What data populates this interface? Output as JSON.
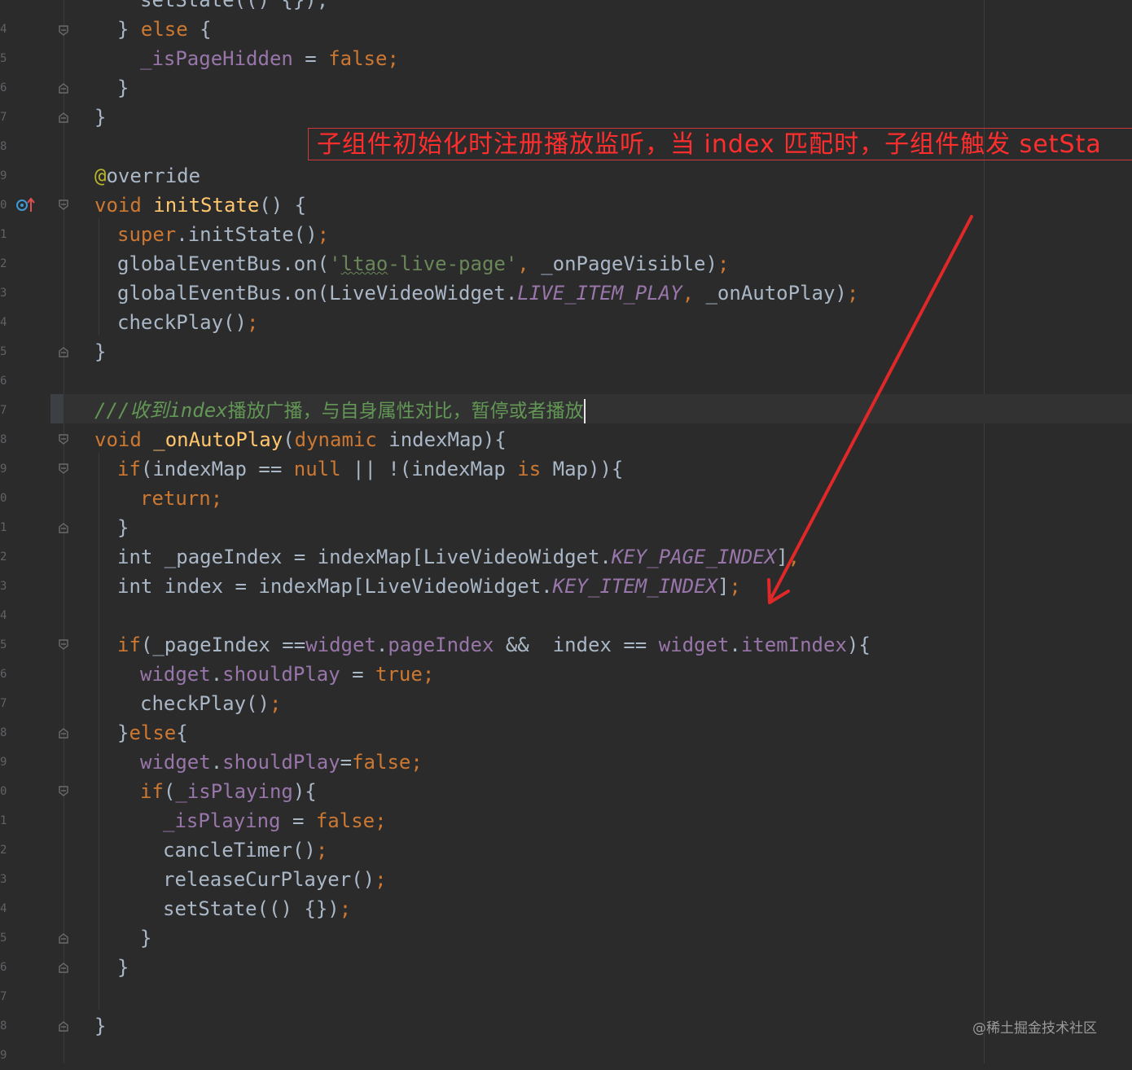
{
  "editor": {
    "line_number_partials": [
      "4",
      "5",
      "6",
      "7",
      "8",
      "9",
      "0",
      "1",
      "2",
      "3",
      "4",
      "5",
      "6",
      "7",
      "8",
      "9",
      "0",
      "1",
      "2",
      "3",
      "4",
      "5",
      "6",
      "7",
      "8",
      "9",
      "0",
      "1",
      "2",
      "3",
      "4",
      "5",
      "6",
      "7",
      "8",
      "9"
    ],
    "code": {
      "l0": "setState(() {});",
      "l1_a": "} ",
      "l1_b": "else",
      "l1_c": " {",
      "l2_a": "_isPageHidden",
      "l2_b": " = ",
      "l2_c": "false",
      "l2_d": ";",
      "l3": "}",
      "l4": "}",
      "l6_a": "@",
      "l6_b": "override",
      "l7_a": "void",
      "l7_b": " ",
      "l7_c": "initState",
      "l7_d": "() {",
      "l8_a": "super",
      "l8_b": ".initState()",
      "l8_c": ";",
      "l9_a": "globalEventBus.on(",
      "l9_b": "'",
      "l9_c": "ltao",
      "l9_d": "-live-page'",
      "l9_e": ", ",
      "l9_f": "_onPageVisible)",
      "l9_g": ";",
      "l10_a": "globalEventBus.on(LiveVideoWidget.",
      "l10_b": "LIVE_ITEM_PLAY",
      "l10_c": ", ",
      "l10_d": "_onAutoPlay)",
      "l10_e": ";",
      "l11_a": "checkPlay()",
      "l11_b": ";",
      "l12": "}",
      "l14_a": "///收到",
      "l14_b": "index",
      "l14_c": "播放广播，与自身属性对比，暂停或者播放",
      "l15_a": "void",
      "l15_b": " ",
      "l15_c": "_onAutoPlay",
      "l15_d": "(",
      "l15_e": "dynamic",
      "l15_f": " indexMap){",
      "l16_a": "if",
      "l16_b": "(indexMap == ",
      "l16_c": "null",
      "l16_d": " || !(indexMap ",
      "l16_e": "is",
      "l16_f": " Map)){",
      "l17_a": "return",
      "l17_b": ";",
      "l18": "}",
      "l19_a": "int",
      "l19_b": " _pageIndex = indexMap[LiveVideoWidget.",
      "l19_c": "KEY_PAGE_INDEX",
      "l19_d": "]",
      "l19_e": ";",
      "l20_a": "int",
      "l20_b": " index = indexMap[LiveVideoWidget.",
      "l20_c": "KEY_ITEM_INDEX",
      "l20_d": "]",
      "l20_e": ";",
      "l22_a": "if",
      "l22_b": "(_pageIndex ==",
      "l22_c": "widget",
      "l22_d": ".",
      "l22_e": "pageIndex",
      "l22_f": " &&  index == ",
      "l22_g": "widget",
      "l22_h": ".",
      "l22_i": "itemIndex",
      "l22_j": "){",
      "l23_a": "widget",
      "l23_b": ".",
      "l23_c": "shouldPlay",
      "l23_d": " = ",
      "l23_e": "true",
      "l23_f": ";",
      "l24_a": "checkPlay()",
      "l24_b": ";",
      "l25_a": "}",
      "l25_b": "else",
      "l25_c": "{",
      "l26_a": "widget",
      "l26_b": ".",
      "l26_c": "shouldPlay",
      "l26_d": "=",
      "l26_e": "false",
      "l26_f": ";",
      "l27_a": "if",
      "l27_b": "(",
      "l27_c": "_isPlaying",
      "l27_d": "){",
      "l28_a": "_isPlaying",
      "l28_b": " = ",
      "l28_c": "false",
      "l28_d": ";",
      "l29_a": "cancleTimer()",
      "l29_b": ";",
      "l30_a": "releaseCurPlayer()",
      "l30_b": ";",
      "l31_a": "setState(() {})",
      "l31_b": ";",
      "l32": "}",
      "l33": "}",
      "l35": "}"
    }
  },
  "annotation": {
    "text": "子组件初始化时注册播放监听，当 index 匹配时，子组件触发 setSta",
    "color": "#ff2e2e"
  },
  "watermark": "@稀土掘金技术社区",
  "colors": {
    "background": "#2b2b2b",
    "keyword": "#cc7832",
    "function": "#ffc66d",
    "string": "#6a8759",
    "field": "#9876aa",
    "annotation_arrow": "#e02828"
  },
  "icons": [
    "fold-icon",
    "override-gutter-icon"
  ]
}
